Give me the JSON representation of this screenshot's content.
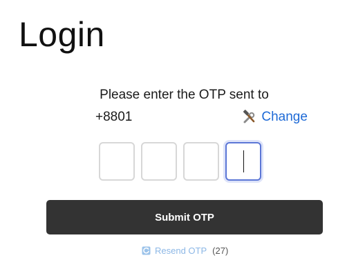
{
  "page": {
    "title": "Login"
  },
  "otp": {
    "instruction": "Please enter the OTP sent to",
    "phone_visible": "+8801",
    "change_label": "Change",
    "submit_label": "Submit OTP",
    "resend_label": "Resend OTP",
    "countdown": "(27)",
    "digits": [
      "",
      "",
      "",
      ""
    ],
    "active_index": 3
  },
  "icons": {
    "change": "tools-icon",
    "resend": "refresh-icon"
  },
  "colors": {
    "link": "#1e6ad6",
    "button_bg": "#333333",
    "active_border": "#5b76d6",
    "resend_link": "#8cb7e6"
  }
}
